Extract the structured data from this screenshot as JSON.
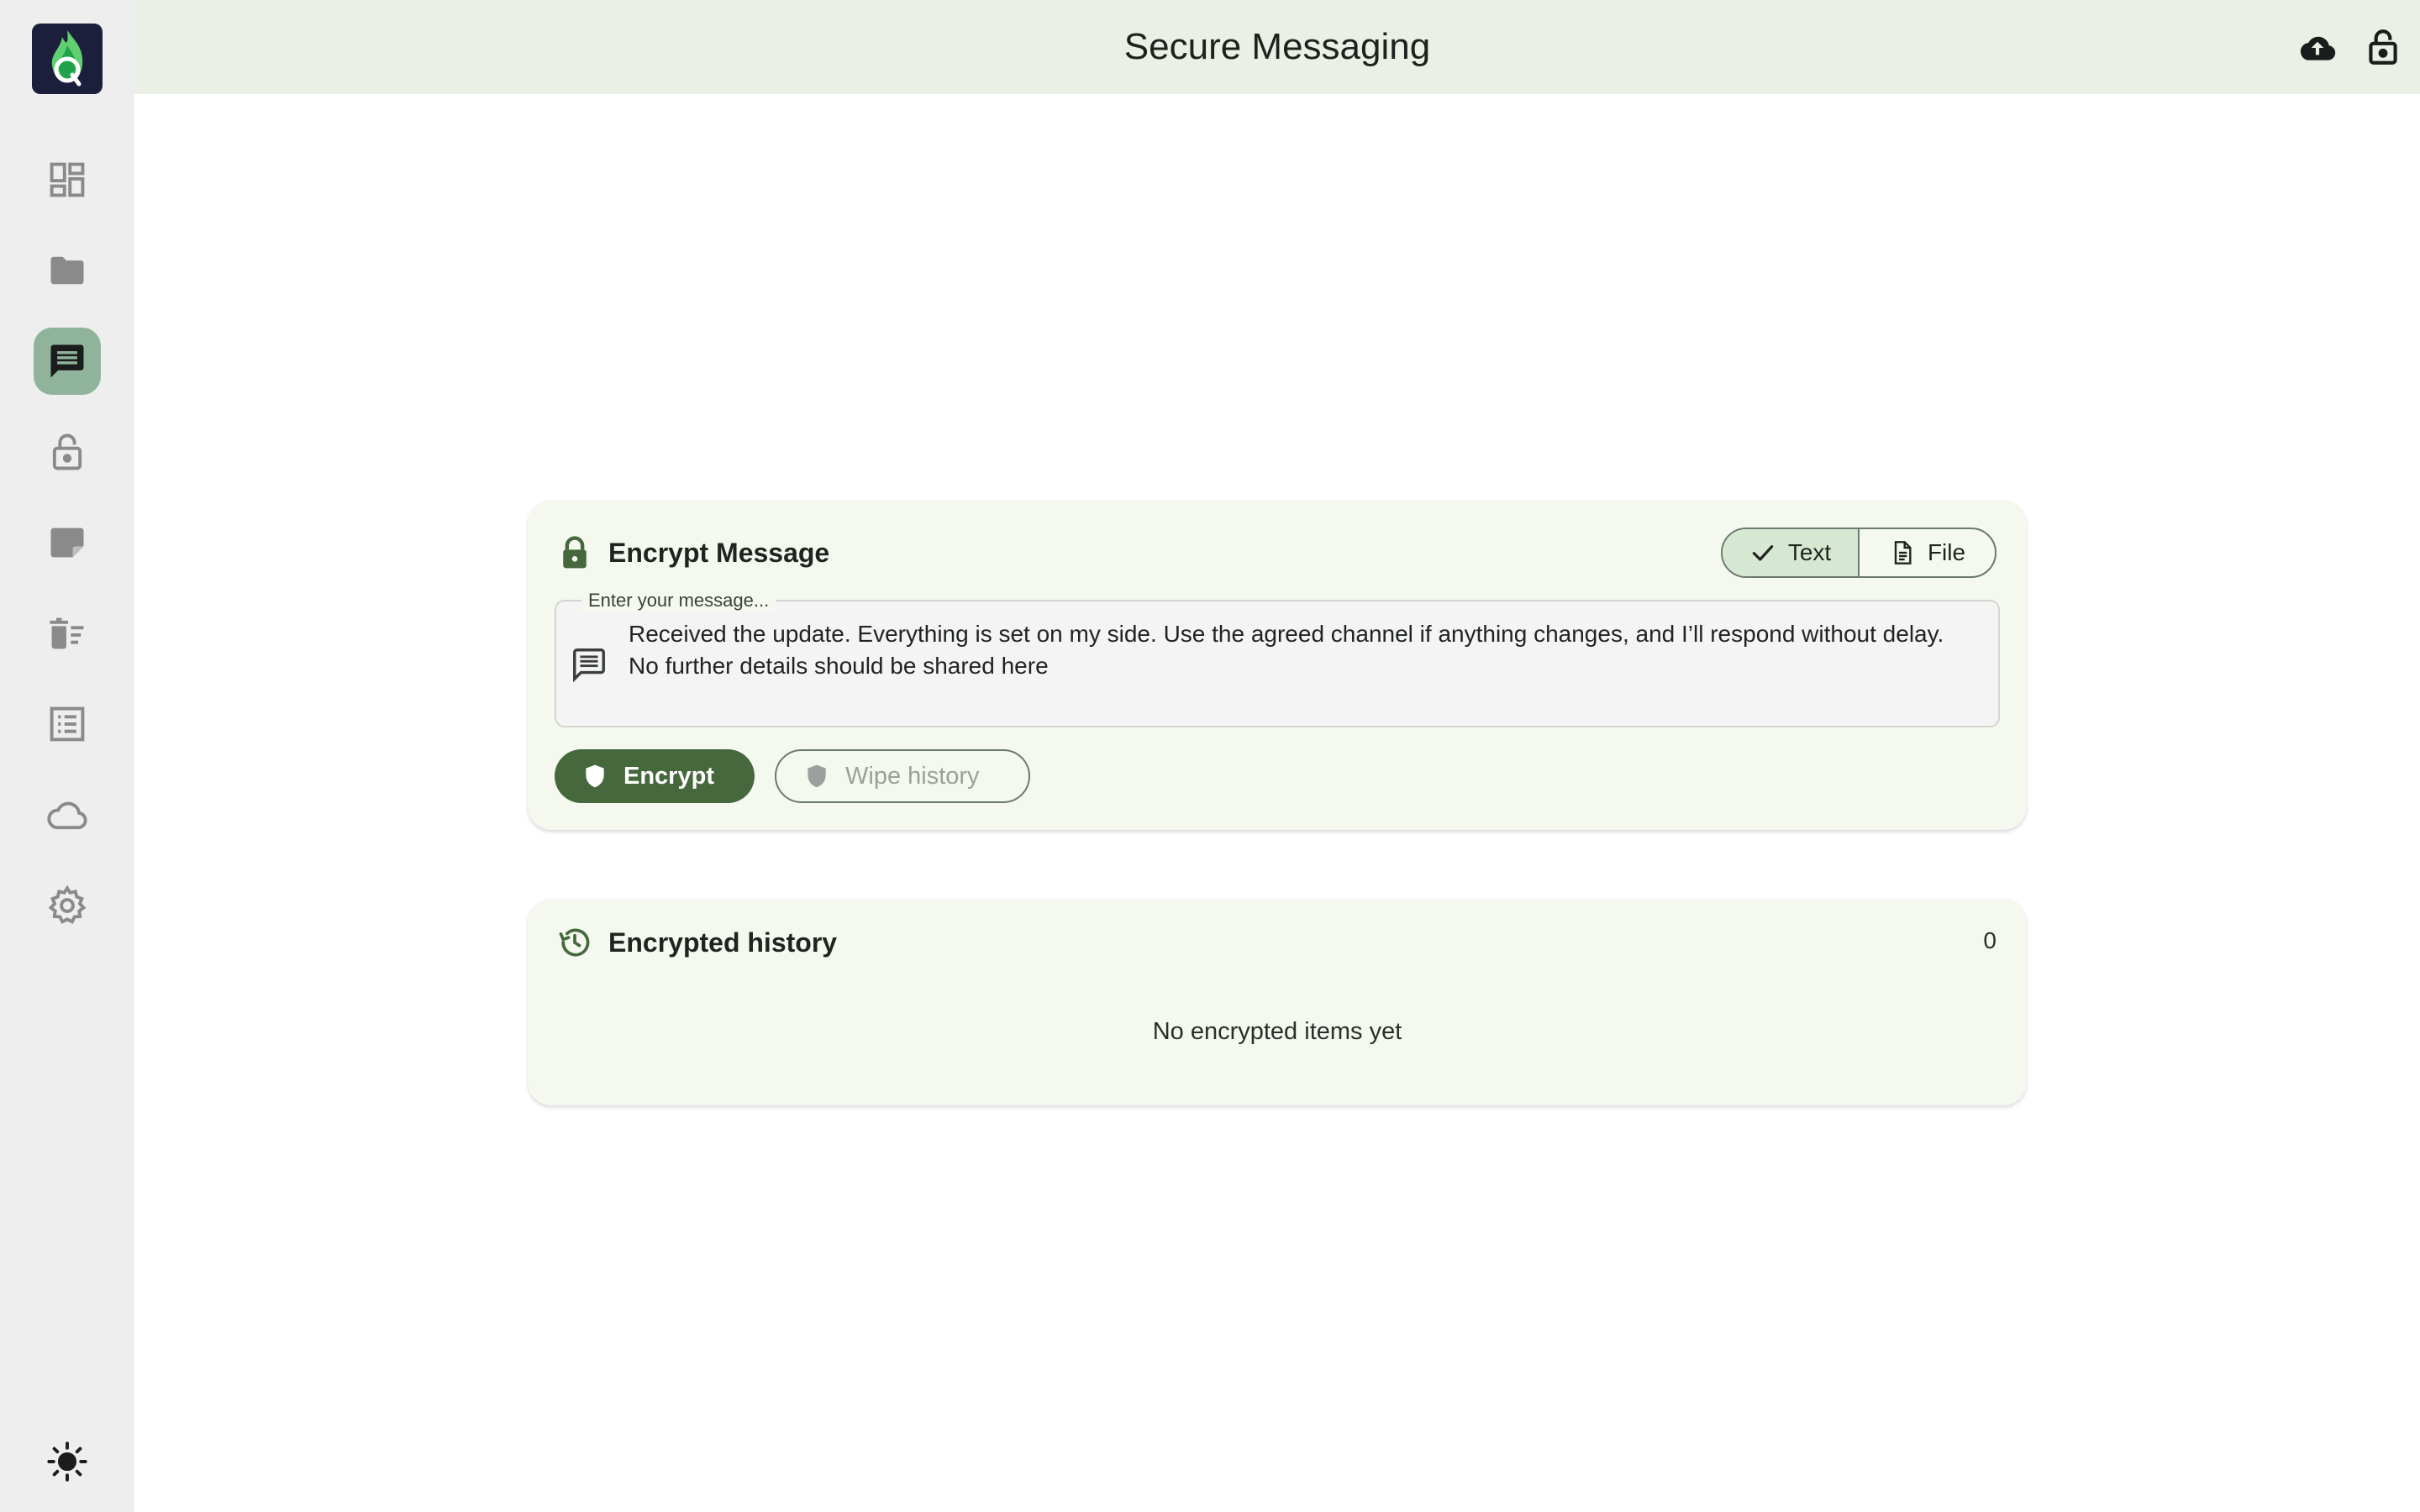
{
  "header": {
    "title": "Secure Messaging"
  },
  "encrypt_card": {
    "title": "Encrypt Message",
    "mode_toggle": {
      "text_label": "Text",
      "file_label": "File",
      "selected": "Text"
    },
    "message_field": {
      "label": "Enter your message...",
      "value": "Received the update. Everything is set on my side. Use the agreed channel if anything changes, and I’ll respond without delay. No further details should be shared here"
    },
    "encrypt_button": "Encrypt",
    "wipe_button": "Wipe history"
  },
  "history_card": {
    "title": "Encrypted history",
    "count": "0",
    "empty_text": "No encrypted items yet"
  },
  "colors": {
    "accent": "#45683c",
    "active_nav": "#8fb49b",
    "header_bg": "#ebf0e6",
    "card_bg": "#f5f8ef",
    "sidebar_bg": "#eeeeee"
  }
}
